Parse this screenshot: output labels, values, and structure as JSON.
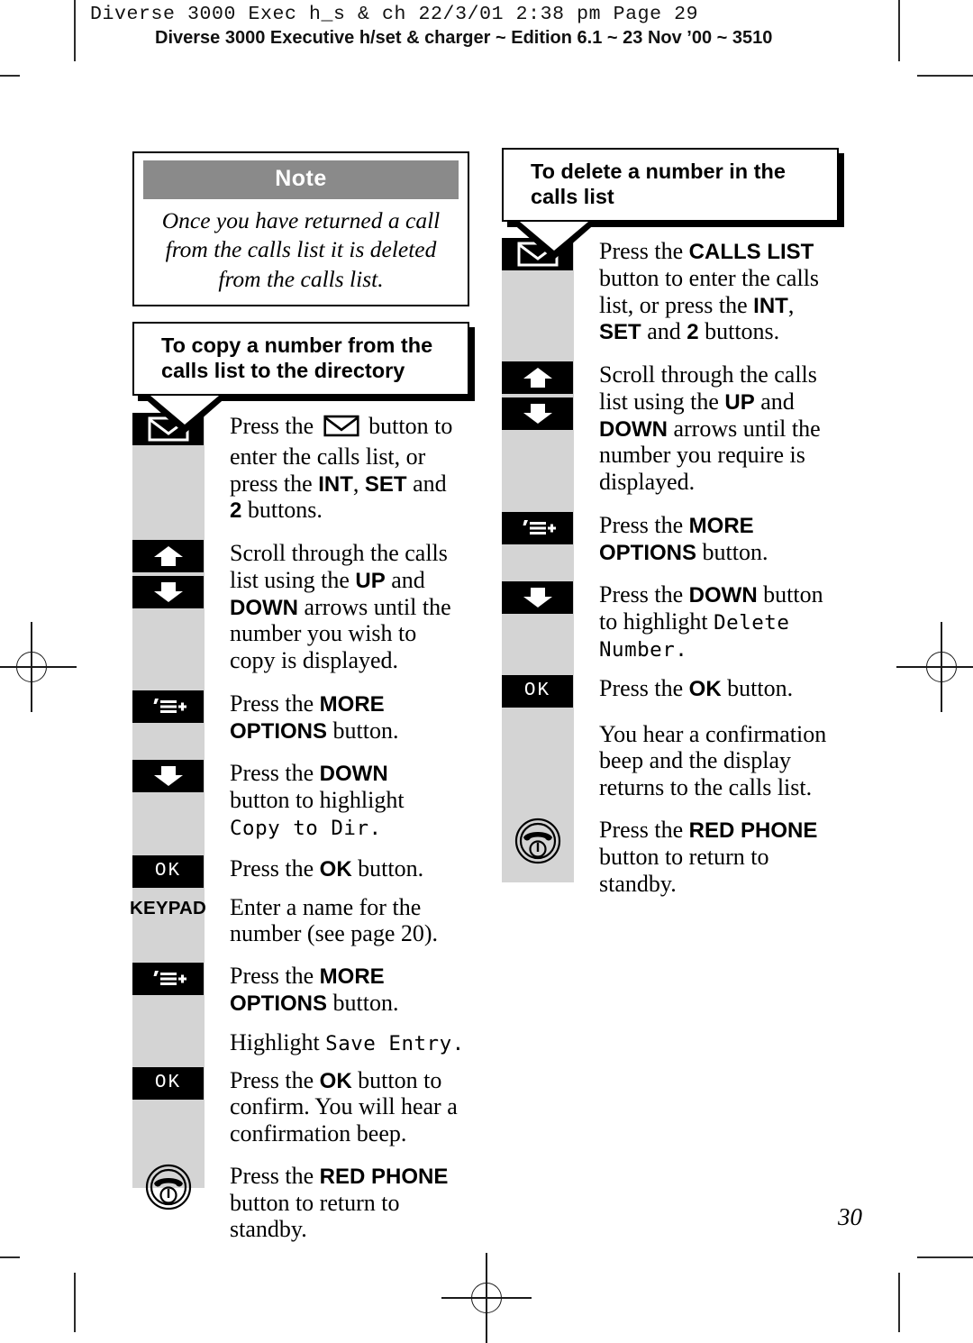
{
  "header": {
    "mono_line": "Diverse 3000 Exec h_s & ch  22/3/01  2:38 pm  Page 29",
    "sans_line": "Diverse 3000 Executive h/set & charger ~ Edition 6.1 ~ 23 Nov ’00 ~ 3510"
  },
  "page_number": "30",
  "colors": {
    "note_title_bg": "#8a8a8a",
    "gutter_bg": "#d4d4d4",
    "key_bg": "#000000",
    "page_bg": "#ffffff"
  },
  "note": {
    "title": "Note",
    "body": "Once you have returned a call from the calls list it is deleted from the calls list."
  },
  "left_column": {
    "heading": "To copy a number from the calls list to the directory",
    "steps": [
      {
        "icon": "envelope-key-icon",
        "icon_label": "",
        "text": "Press the ✉ button to enter the calls list, or press the INT, SET and 2 buttons."
      },
      {
        "icon": "up-arrow-key-icon",
        "icon_label": "",
        "text": "Scroll through the calls list using the UP and DOWN arrows until the number you wish to copy is displayed."
      },
      {
        "icon": "down-arrow-key-icon",
        "icon_label": "",
        "text": ""
      },
      {
        "icon": "more-options-key-icon",
        "icon_label": "’≡+",
        "text": "Press the MORE OPTIONS button."
      },
      {
        "icon": "down-arrow-key-icon",
        "icon_label": "",
        "text": "Press the DOWN button to highlight Copy to Dir."
      },
      {
        "icon": "ok-key-icon",
        "icon_label": "OK",
        "text": "Press the OK button."
      },
      {
        "icon": "keypad-key-icon",
        "icon_label": "KEYPAD",
        "text": "Enter a name for the number (see page 20)."
      },
      {
        "icon": "more-options-key-icon",
        "icon_label": "’≡+",
        "text": "Press the MORE OPTIONS button."
      },
      {
        "icon": "none",
        "icon_label": "",
        "text": "Highlight Save Entry."
      },
      {
        "icon": "ok-key-icon",
        "icon_label": "OK",
        "text": "Press the OK button to confirm. You will hear a confirmation beep."
      },
      {
        "icon": "red-phone-key-icon",
        "icon_label": "",
        "text": "Press the RED PHONE button to return to standby."
      }
    ],
    "lcd_texts": [
      "Copy to Dir.",
      "Save Entry."
    ]
  },
  "right_column": {
    "heading": "To delete a number in the calls list",
    "steps": [
      {
        "icon": "envelope-key-icon",
        "icon_label": "",
        "text": "Press the CALLS LIST button to enter the calls list, or press the INT, SET and 2 buttons."
      },
      {
        "icon": "up-arrow-key-icon",
        "icon_label": "",
        "text": "Scroll through the calls list using the UP and DOWN arrows until the number you require is displayed."
      },
      {
        "icon": "down-arrow-key-icon",
        "icon_label": "",
        "text": ""
      },
      {
        "icon": "more-options-key-icon",
        "icon_label": "’≡+",
        "text": "Press the MORE OPTIONS button."
      },
      {
        "icon": "down-arrow-key-icon",
        "icon_label": "",
        "text": "Press the DOWN button to highlight Delete Number."
      },
      {
        "icon": "ok-key-icon",
        "icon_label": "OK",
        "text": "Press the OK button."
      },
      {
        "icon": "none",
        "icon_label": "",
        "text": "You hear a confirmation beep and the display returns to the calls list."
      },
      {
        "icon": "red-phone-key-icon",
        "icon_label": "",
        "text": "Press the RED PHONE button to return to standby."
      }
    ],
    "lcd_texts": [
      "Delete Number."
    ]
  },
  "fragments": {
    "press_the": "Press the ",
    "button_to": " button to",
    "enter_calls_list_or": "enter the calls list, or",
    "press_the_int": "press the ",
    "int": "INT",
    "set": "SET",
    "and": " and",
    "two": "2",
    "buttons": " buttons.",
    "scroll_through": "Scroll through the calls",
    "list_using_the": "list using the ",
    "up": "UP",
    "down": "DOWN",
    "arrows_until_the": " arrows until the",
    "number_you_wish_to": "number you wish to",
    "copy_is_displayed": "copy is displayed.",
    "number_you_require_is": "number you require is",
    "displayed": "displayed.",
    "more": "MORE",
    "options": "OPTIONS",
    "button_period": " button.",
    "button_word": " button",
    "to_highlight": "to highlight ",
    "button_to_highlight": "button to highlight",
    "copy_to_dir": "Copy to Dir.",
    "delete": "Delete",
    "number_lcd": "Number.",
    "ok": "OK",
    "enter_a_name_for_the": "Enter a name for the",
    "number_see_page": "number (see page 20).",
    "highlight": "Highlight ",
    "save_entry": "Save Entry.",
    "button_to_confirm": " button to",
    "confirm_you_will_hear_a": "confirm. You will hear a",
    "confirmation_beep": "confirmation beep.",
    "red_phone": "RED PHONE",
    "button_to_return_to": "button to return to",
    "standby": "standby.",
    "calls_list": "CALLS LIST",
    "button_to_enter_the_calls": "button to enter the calls",
    "list_or_press_the": "list, or press the ",
    "you_hear_a_confirmation": "You hear a confirmation",
    "beep_and_the_display": "beep and the display",
    "returns_to_the_calls_list": "returns to the calls list."
  }
}
